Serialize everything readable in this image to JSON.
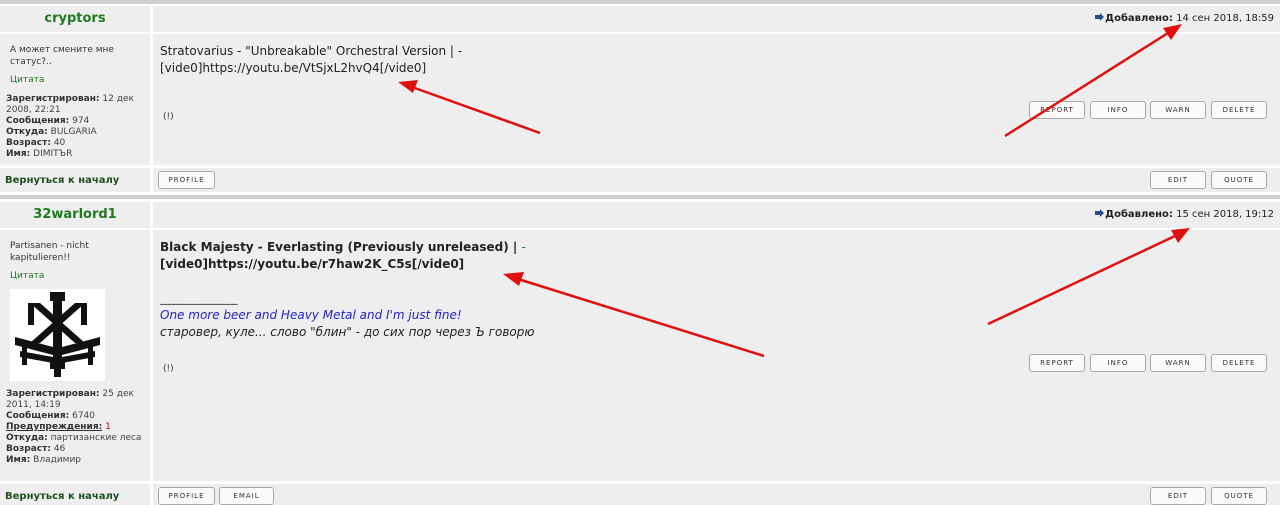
{
  "posts": [
    {
      "author": "cryptors",
      "date_label": "Добавлено:",
      "date_value": "14 сен 2018, 18:59",
      "status": "А может смените мне статус?..",
      "quote_link": "Цитата",
      "profile": {
        "registered_label": "Зарегистрирован:",
        "registered_value": "12 дек 2008, 22:21",
        "messages_label": "Сообщения:",
        "messages_value": "974",
        "from_label": "Откуда:",
        "from_value": "BULGARIA",
        "age_label": "Возраст:",
        "age_value": "40",
        "name_label": "Имя:",
        "name_value": "DIMITЪR"
      },
      "message_line1": "Stratovarius - \"Unbreakable\" Orchestral Version | -",
      "message_line2": "[vide0]https://youtu.be/VtSjxL2hvQ4[/vide0]",
      "excl": "(!)",
      "buttons": [
        "REPORT",
        "INFO",
        "WARN",
        "DELETE"
      ],
      "footer_left": [
        "PROFILE"
      ],
      "footer_right": [
        "EDIT",
        "QUOTE"
      ],
      "back_link": "Вернуться к началу"
    },
    {
      "author": "32warlord1",
      "date_label": "Добавлено:",
      "date_value": "15 сен 2018, 19:12",
      "status": "Partisanen - nicht kapitulieren!!",
      "quote_link": "Цитата",
      "profile": {
        "registered_label": "Зарегистрирован:",
        "registered_value": "25 дек 2011, 14:19",
        "messages_label": "Сообщения:",
        "messages_value": "6740",
        "warnings_label": "Предупреждения:",
        "warnings_value": "1",
        "from_label": "Откуда:",
        "from_value": "партизанские леса",
        "age_label": "Возраст:",
        "age_value": "46",
        "name_label": "Имя:",
        "name_value": "Владимир"
      },
      "message_line1": "Black Majesty - Everlasting (Previously unreleased) |",
      "message_line1_tail": "-",
      "message_line2": "[vide0]https://youtu.be/r7haw2K_C5s[/vide0]",
      "sig_divider": "_________________",
      "sig_line1": "One more beer and Heavy Metal and I'm just fine!",
      "sig_line2": "старовер, куле... слово \"блин\" - до сих пор через Ъ говорю",
      "excl": "(!)",
      "buttons": [
        "REPORT",
        "INFO",
        "WARN",
        "DELETE"
      ],
      "footer_left": [
        "PROFILE",
        "EMAIL"
      ],
      "footer_right": [
        "EDIT",
        "QUOTE"
      ],
      "back_link": "Вернуться к началу"
    }
  ],
  "colors": {
    "background": "#eeeeee",
    "author_green": "#1f7a1f",
    "signature_blue": "#2424cc",
    "annotation_red": "#e01010"
  }
}
